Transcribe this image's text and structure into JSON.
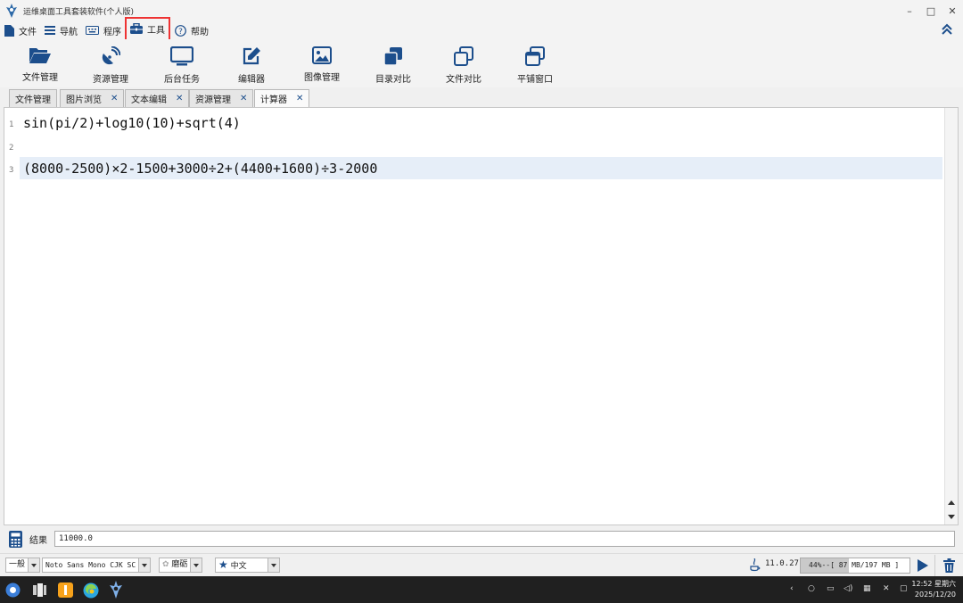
{
  "window": {
    "title": "运维桌面工具套装软件(个人版)",
    "controls": [
      "–",
      "□",
      "✕"
    ]
  },
  "menu": {
    "items": [
      {
        "label": "文件",
        "icon": "file-icon"
      },
      {
        "label": "导航",
        "icon": "list-icon"
      },
      {
        "label": "程序",
        "icon": "keyboard-icon"
      },
      {
        "label": "工具",
        "icon": "toolbox-icon",
        "highlighted": true
      },
      {
        "label": "帮助",
        "icon": "help-icon"
      }
    ]
  },
  "toolbar": {
    "items": [
      {
        "label": "文件管理",
        "icon": "folder-open-icon"
      },
      {
        "label": "资源管理",
        "icon": "satellite-dish-icon"
      },
      {
        "label": "后台任务",
        "icon": "monitor-icon"
      },
      {
        "label": "编辑器",
        "icon": "edit-icon"
      },
      {
        "label": "图像管理",
        "icon": "image-icon"
      },
      {
        "label": "目录对比",
        "icon": "copy-filled-icon"
      },
      {
        "label": "文件对比",
        "icon": "copy-outline-icon"
      },
      {
        "label": "平铺窗口",
        "icon": "windows-icon"
      }
    ]
  },
  "tabs": [
    {
      "label": "文件管理",
      "closable": false,
      "active": false
    },
    {
      "label": "图片浏览",
      "closable": true,
      "active": false
    },
    {
      "label": "文本编辑",
      "closable": true,
      "active": false
    },
    {
      "label": "资源管理",
      "closable": true,
      "active": false
    },
    {
      "label": "计算器",
      "closable": true,
      "active": true
    }
  ],
  "editor": {
    "lines": [
      {
        "num": "1",
        "text": "sin(pi/2)+log10(10)+sqrt(4)"
      },
      {
        "num": "2",
        "text": ""
      },
      {
        "num": "3",
        "text": "(8000-2500)×2-1500+3000÷2+(4400+1600)÷3-2000"
      }
    ],
    "highlighted_line": 3
  },
  "result": {
    "label": "结果",
    "value": "11000.0"
  },
  "status": {
    "mode": "一般",
    "font": "Noto Sans Mono CJK SC",
    "theme": "磨砺",
    "language": "中文",
    "java_version": "11.0.27",
    "memory_text": "44%--[ 87 MB/197 MB ]",
    "memory_percent": 44
  },
  "taskbar": {
    "time": "12:52 星期六",
    "date": "2025/12/20"
  },
  "colors": {
    "accent": "#1c4e8c",
    "highlight_border": "#e33333",
    "line_highlight": "#e6eef8"
  }
}
